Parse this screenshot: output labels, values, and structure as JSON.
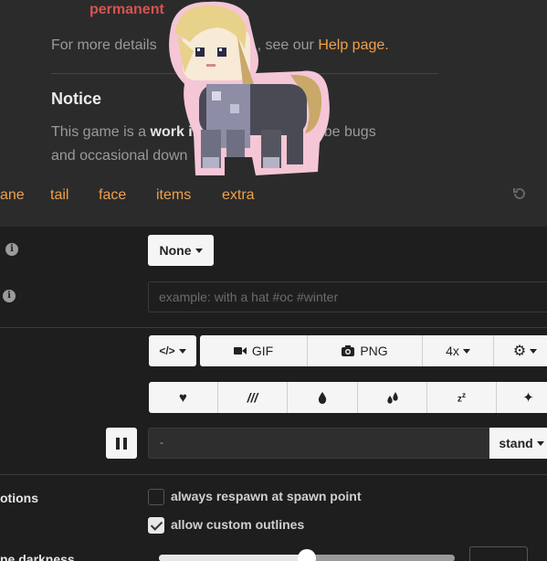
{
  "top": {
    "permanent_text": "permanent",
    "help_prefix": "For more details",
    "help_middle": ", see our",
    "help_link": "Help page.",
    "notice_title": "Notice",
    "notice_pre": "This game is a",
    "notice_bold": "work in",
    "notice_mid": "ight be bugs",
    "notice_line2": "and occasional down"
  },
  "tabs": [
    "ane",
    "tail",
    "face",
    "items",
    "extra"
  ],
  "controls": {
    "cm_select": "None",
    "tags_placeholder": "example: with a hat #oc #winter",
    "code_label": "</>",
    "gif_label": "GIF",
    "png_label": "PNG",
    "scale_label": "4x",
    "anim_value": "-",
    "state_select": "stand"
  },
  "options": {
    "section_label": "otions",
    "respawn_label": "always respawn at spawn point",
    "respawn_checked": false,
    "outlines_label": "allow custom outlines",
    "outlines_checked": true,
    "darkness_label": "ne darkness",
    "darkness_level": 0.5
  },
  "colors": {
    "accent": "#f0a04b",
    "danger": "#d9534f",
    "panel": "#1e1e1e"
  }
}
